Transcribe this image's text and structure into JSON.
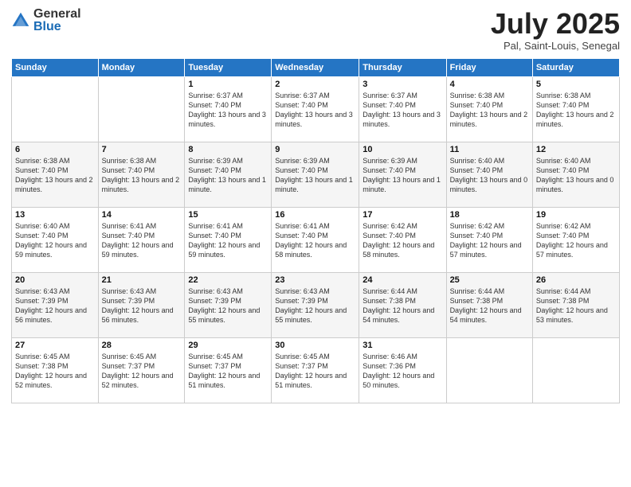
{
  "logo": {
    "general": "General",
    "blue": "Blue"
  },
  "title": "July 2025",
  "location": "Pal, Saint-Louis, Senegal",
  "days_of_week": [
    "Sunday",
    "Monday",
    "Tuesday",
    "Wednesday",
    "Thursday",
    "Friday",
    "Saturday"
  ],
  "weeks": [
    [
      {
        "day": "",
        "detail": ""
      },
      {
        "day": "",
        "detail": ""
      },
      {
        "day": "1",
        "detail": "Sunrise: 6:37 AM\nSunset: 7:40 PM\nDaylight: 13 hours and 3 minutes."
      },
      {
        "day": "2",
        "detail": "Sunrise: 6:37 AM\nSunset: 7:40 PM\nDaylight: 13 hours and 3 minutes."
      },
      {
        "day": "3",
        "detail": "Sunrise: 6:37 AM\nSunset: 7:40 PM\nDaylight: 13 hours and 3 minutes."
      },
      {
        "day": "4",
        "detail": "Sunrise: 6:38 AM\nSunset: 7:40 PM\nDaylight: 13 hours and 2 minutes."
      },
      {
        "day": "5",
        "detail": "Sunrise: 6:38 AM\nSunset: 7:40 PM\nDaylight: 13 hours and 2 minutes."
      }
    ],
    [
      {
        "day": "6",
        "detail": "Sunrise: 6:38 AM\nSunset: 7:40 PM\nDaylight: 13 hours and 2 minutes."
      },
      {
        "day": "7",
        "detail": "Sunrise: 6:38 AM\nSunset: 7:40 PM\nDaylight: 13 hours and 2 minutes."
      },
      {
        "day": "8",
        "detail": "Sunrise: 6:39 AM\nSunset: 7:40 PM\nDaylight: 13 hours and 1 minute."
      },
      {
        "day": "9",
        "detail": "Sunrise: 6:39 AM\nSunset: 7:40 PM\nDaylight: 13 hours and 1 minute."
      },
      {
        "day": "10",
        "detail": "Sunrise: 6:39 AM\nSunset: 7:40 PM\nDaylight: 13 hours and 1 minute."
      },
      {
        "day": "11",
        "detail": "Sunrise: 6:40 AM\nSunset: 7:40 PM\nDaylight: 13 hours and 0 minutes."
      },
      {
        "day": "12",
        "detail": "Sunrise: 6:40 AM\nSunset: 7:40 PM\nDaylight: 13 hours and 0 minutes."
      }
    ],
    [
      {
        "day": "13",
        "detail": "Sunrise: 6:40 AM\nSunset: 7:40 PM\nDaylight: 12 hours and 59 minutes."
      },
      {
        "day": "14",
        "detail": "Sunrise: 6:41 AM\nSunset: 7:40 PM\nDaylight: 12 hours and 59 minutes."
      },
      {
        "day": "15",
        "detail": "Sunrise: 6:41 AM\nSunset: 7:40 PM\nDaylight: 12 hours and 59 minutes."
      },
      {
        "day": "16",
        "detail": "Sunrise: 6:41 AM\nSunset: 7:40 PM\nDaylight: 12 hours and 58 minutes."
      },
      {
        "day": "17",
        "detail": "Sunrise: 6:42 AM\nSunset: 7:40 PM\nDaylight: 12 hours and 58 minutes."
      },
      {
        "day": "18",
        "detail": "Sunrise: 6:42 AM\nSunset: 7:40 PM\nDaylight: 12 hours and 57 minutes."
      },
      {
        "day": "19",
        "detail": "Sunrise: 6:42 AM\nSunset: 7:40 PM\nDaylight: 12 hours and 57 minutes."
      }
    ],
    [
      {
        "day": "20",
        "detail": "Sunrise: 6:43 AM\nSunset: 7:39 PM\nDaylight: 12 hours and 56 minutes."
      },
      {
        "day": "21",
        "detail": "Sunrise: 6:43 AM\nSunset: 7:39 PM\nDaylight: 12 hours and 56 minutes."
      },
      {
        "day": "22",
        "detail": "Sunrise: 6:43 AM\nSunset: 7:39 PM\nDaylight: 12 hours and 55 minutes."
      },
      {
        "day": "23",
        "detail": "Sunrise: 6:43 AM\nSunset: 7:39 PM\nDaylight: 12 hours and 55 minutes."
      },
      {
        "day": "24",
        "detail": "Sunrise: 6:44 AM\nSunset: 7:38 PM\nDaylight: 12 hours and 54 minutes."
      },
      {
        "day": "25",
        "detail": "Sunrise: 6:44 AM\nSunset: 7:38 PM\nDaylight: 12 hours and 54 minutes."
      },
      {
        "day": "26",
        "detail": "Sunrise: 6:44 AM\nSunset: 7:38 PM\nDaylight: 12 hours and 53 minutes."
      }
    ],
    [
      {
        "day": "27",
        "detail": "Sunrise: 6:45 AM\nSunset: 7:38 PM\nDaylight: 12 hours and 52 minutes."
      },
      {
        "day": "28",
        "detail": "Sunrise: 6:45 AM\nSunset: 7:37 PM\nDaylight: 12 hours and 52 minutes."
      },
      {
        "day": "29",
        "detail": "Sunrise: 6:45 AM\nSunset: 7:37 PM\nDaylight: 12 hours and 51 minutes."
      },
      {
        "day": "30",
        "detail": "Sunrise: 6:45 AM\nSunset: 7:37 PM\nDaylight: 12 hours and 51 minutes."
      },
      {
        "day": "31",
        "detail": "Sunrise: 6:46 AM\nSunset: 7:36 PM\nDaylight: 12 hours and 50 minutes."
      },
      {
        "day": "",
        "detail": ""
      },
      {
        "day": "",
        "detail": ""
      }
    ]
  ]
}
